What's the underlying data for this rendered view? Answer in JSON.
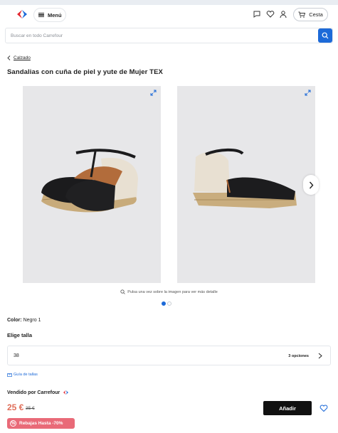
{
  "header": {
    "menu_label": "Menú",
    "cart_label": "Cesta"
  },
  "search": {
    "placeholder": "Buscar en todo Carrefour"
  },
  "breadcrumb": {
    "label": "Calzado"
  },
  "product": {
    "title": "Sandalias con cuña de piel y yute de Mujer TEX",
    "image_hint": "Pulsa una vez sobre la imagen para ver más detalle",
    "color_label": "Color:",
    "color_value": "Negro 1",
    "size_title": "Elige talla",
    "size_value": "38",
    "size_options": "3 opciones",
    "size_guide": "Guía de tallas",
    "seller": "Vendido por Carrefour",
    "price": "25 €",
    "old_price": "35 €",
    "add_label": "Añadir",
    "promo_label": "Rebajas Hasta -70%"
  },
  "colors": {
    "accent": "#1d6ad8",
    "price": "#e06f5a",
    "promo": "#e96a78",
    "add_button": "#111111"
  }
}
